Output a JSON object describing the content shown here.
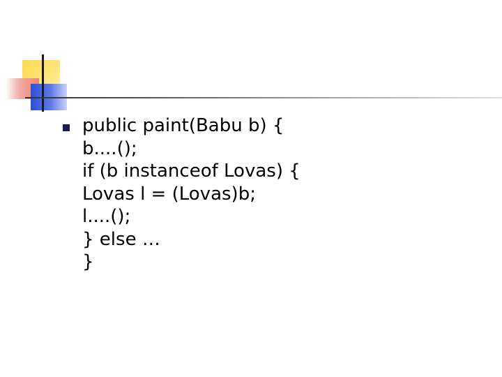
{
  "slide": {
    "bullet_lines": [
      "public paint(Babu b) {",
      "b....();",
      "if (b instanceof Lovas) {",
      "Lovas l = (Lovas)b;",
      "l....();",
      "} else …",
      "}"
    ]
  },
  "colors": {
    "deco_yellow": "#ffd84a",
    "deco_red": "#ef7b7b",
    "deco_blue": "#2b4fd6",
    "bullet": "#1b1b5a",
    "text": "#000000"
  }
}
